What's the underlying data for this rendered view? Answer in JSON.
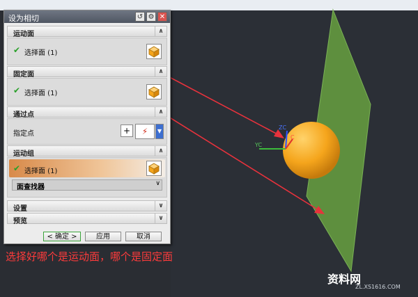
{
  "dialog": {
    "title": "设为相切",
    "sections": {
      "moving_face": {
        "header": "运动面",
        "item": "选择面 (1)"
      },
      "fixed_face": {
        "header": "固定面",
        "item": "选择面 (1)"
      },
      "through_point": {
        "header": "通过点",
        "item": "指定点"
      },
      "moving_group": {
        "header": "运动组",
        "item": "选择面 (1)",
        "finder": "面查找器"
      },
      "settings": {
        "header": "设置"
      },
      "preview": {
        "header": "预览"
      }
    },
    "buttons": {
      "ok": "< 确定 >",
      "apply": "应用",
      "cancel": "取消"
    }
  },
  "viewport": {
    "axis_labels": {
      "zc": "ZC",
      "yc": "YC",
      "xc": "C"
    }
  },
  "caption": "选择好哪个是运动面，哪个是固定面",
  "watermark": {
    "brand": "资料网",
    "url": "ZL.XS1616.COM"
  },
  "colors": {
    "arrow": "#e8323c",
    "sphere": "#f5a51c",
    "plane": "#5e8f3e"
  }
}
